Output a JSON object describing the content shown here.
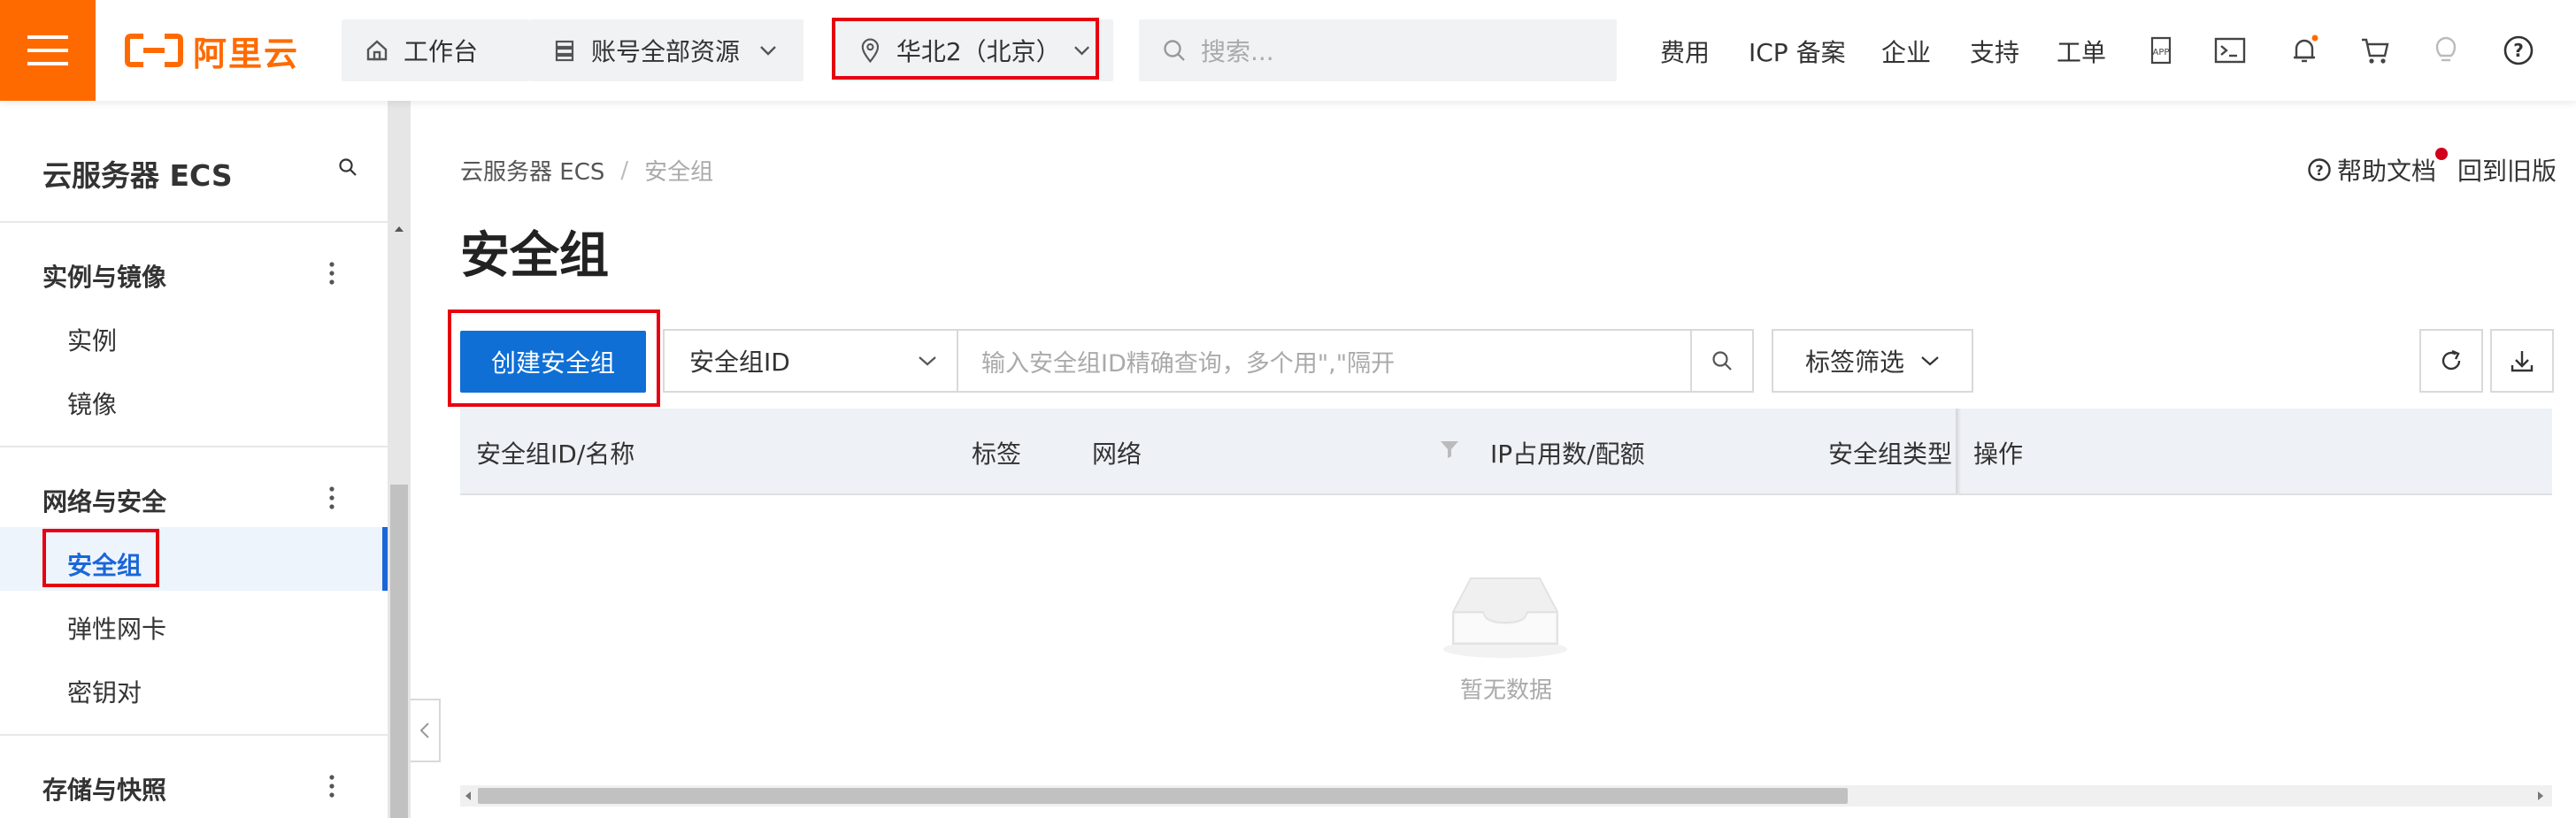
{
  "topbar": {
    "brand": "阿里云",
    "workbench": "工作台",
    "resources": "账号全部资源",
    "region": "华北2（北京）",
    "search_placeholder": "搜索...",
    "nav": [
      "费用",
      "ICP 备案",
      "企业",
      "支持",
      "工单"
    ],
    "icons": [
      "app-icon",
      "terminal-icon",
      "bell-icon",
      "cart-icon",
      "lightbulb-icon",
      "help-icon"
    ]
  },
  "sidebar": {
    "title": "云服务器 ECS",
    "sections": [
      {
        "label": "实例与镜像",
        "items": [
          "实例",
          "镜像"
        ]
      },
      {
        "label": "网络与安全",
        "items": [
          "安全组",
          "弹性网卡",
          "密钥对"
        ]
      },
      {
        "label": "存储与快照",
        "items": []
      }
    ],
    "active_item": "安全组"
  },
  "breadcrumb": {
    "root": "云服务器 ECS",
    "current": "安全组"
  },
  "header_links": {
    "help": "帮助文档",
    "old_version": "回到旧版"
  },
  "page_title": "安全组",
  "toolbar": {
    "create_label": "创建安全组",
    "filter_field": "安全组ID",
    "filter_placeholder": "输入安全组ID精确查询，多个用\",\"隔开",
    "tag_filter": "标签筛选"
  },
  "table": {
    "columns": [
      "安全组ID/名称",
      "标签",
      "网络",
      "IP占用数/配额",
      "安全组类型",
      "操作"
    ],
    "rows": [],
    "empty_text": "暂无数据"
  },
  "colors": {
    "brand": "#ff6a00",
    "primary": "#0f6fd5",
    "highlight": "#e60012"
  }
}
